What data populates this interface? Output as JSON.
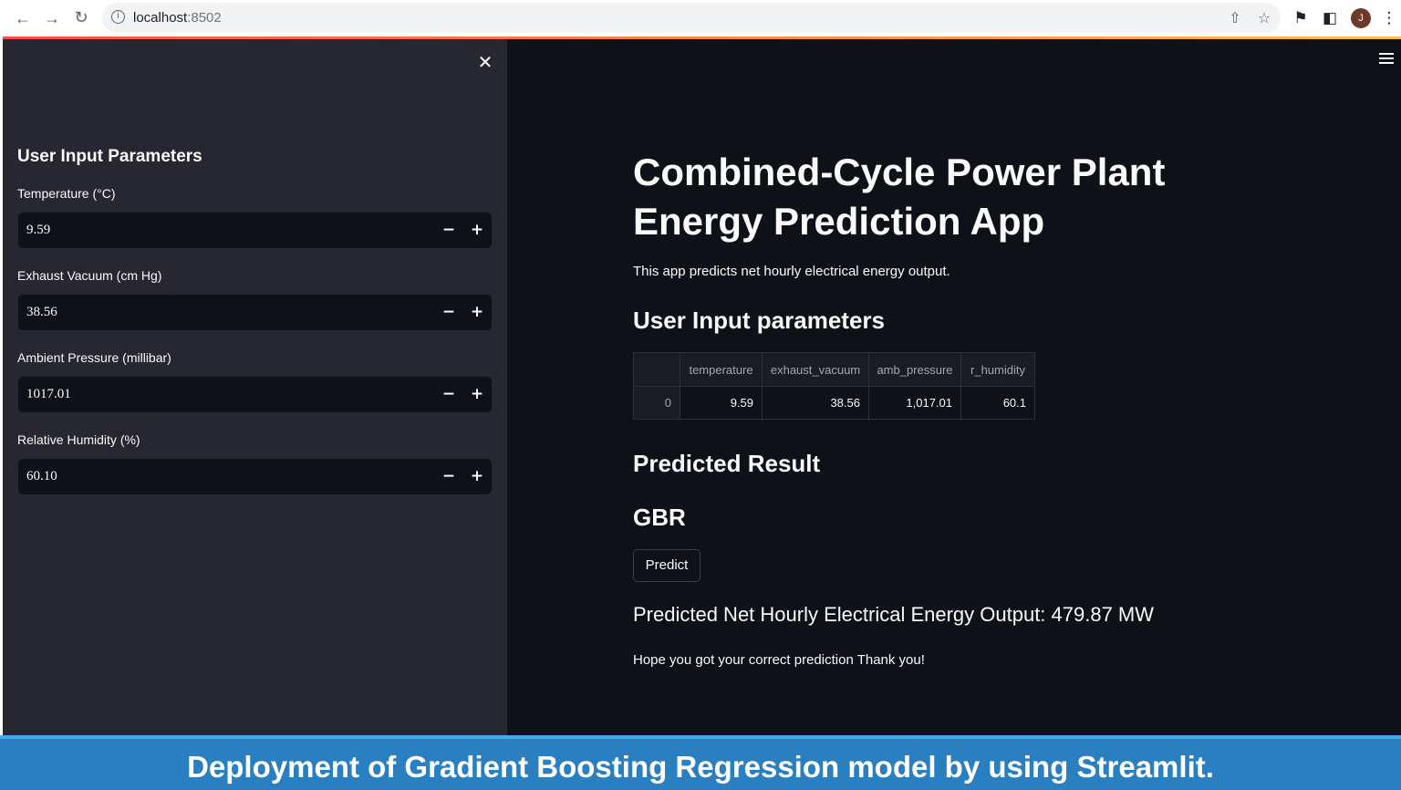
{
  "browser": {
    "url_host": "localhost",
    "url_port": ":8502",
    "avatar_letter": "J"
  },
  "sidebar": {
    "title": "User Input Parameters",
    "fields": [
      {
        "label": "Temperature (°C)",
        "value": "9.59"
      },
      {
        "label": "Exhaust Vacuum (cm Hg)",
        "value": "38.56"
      },
      {
        "label": "Ambient Pressure (millibar)",
        "value": "1017.01"
      },
      {
        "label": "Relative Humidity (%)",
        "value": "60.10"
      }
    ],
    "minus": "−",
    "plus": "+"
  },
  "main": {
    "title": "Combined-Cycle Power Plant Energy Prediction App",
    "description": "This app predicts net hourly electrical energy output.",
    "params_heading": "User Input parameters",
    "table": {
      "columns": [
        "",
        "temperature",
        "exhaust_vacuum",
        "amb_pressure",
        "r_humidity"
      ],
      "rows": [
        [
          "0",
          "9.59",
          "38.56",
          "1,017.01",
          "60.1"
        ]
      ]
    },
    "result_heading": "Predicted Result",
    "model_heading": "GBR",
    "predict_button": "Predict",
    "result_text": "Predicted Net Hourly Electrical Energy Output: 479.87 MW",
    "thanks_text": "Hope you got your correct prediction Thank you!"
  },
  "banner": {
    "text": "Deployment of Gradient Boosting Regression model by using Streamlit."
  },
  "colors": {
    "app_bg": "#0e1117",
    "sidebar_bg": "#262730",
    "banner_bg": "#2a7fc1",
    "text": "#fafafa"
  },
  "icons": [
    "back-arrow-icon",
    "forward-arrow-icon",
    "reload-icon",
    "info-icon",
    "share-icon",
    "star-icon",
    "extensions-icon",
    "side-panel-icon",
    "more-vert-icon",
    "close-icon",
    "hamburger-menu-icon"
  ]
}
